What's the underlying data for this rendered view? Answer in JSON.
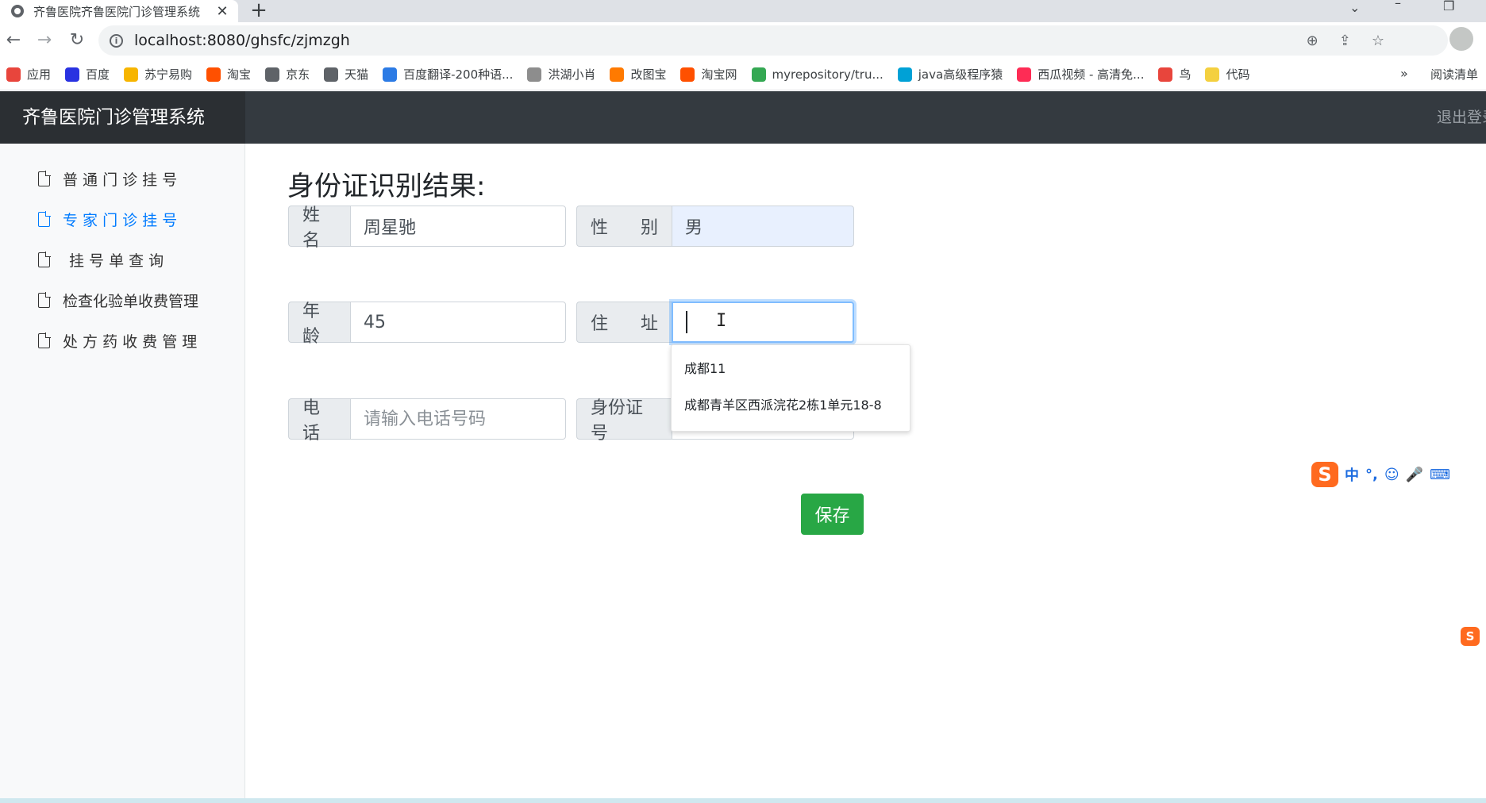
{
  "browser": {
    "tab_title": "齐鲁医院齐鲁医院门诊管理系统",
    "tab_close": "✕",
    "new_tab": "+",
    "url": "localhost:8080/ghsfc/zjmzgh",
    "bookmarks": [
      {
        "label": "应用",
        "color": "#e8453c"
      },
      {
        "label": "百度",
        "color": "#2932e1"
      },
      {
        "label": "苏宁易购",
        "color": "#f7b500"
      },
      {
        "label": "淘宝",
        "color": "#ff5000"
      },
      {
        "label": "京东",
        "color": "#5f6368"
      },
      {
        "label": "天猫",
        "color": "#5f6368"
      },
      {
        "label": "百度翻译-200种语...",
        "color": "#2c7be5"
      },
      {
        "label": "洪湖小肖",
        "color": "#8d8d8d"
      },
      {
        "label": "改图宝",
        "color": "#ff7a00"
      },
      {
        "label": "淘宝网",
        "color": "#ff5000"
      },
      {
        "label": "myrepository/tru...",
        "color": "#34a853"
      },
      {
        "label": "java高级程序猿",
        "color": "#00a1d6"
      },
      {
        "label": "西瓜视频 - 高清免...",
        "color": "#fe2c55"
      },
      {
        "label": "鸟",
        "color": "#e8453c"
      },
      {
        "label": "代码",
        "color": "#f4d03f"
      }
    ],
    "bookmarks_more": "»",
    "reading_list": "阅读清单"
  },
  "app": {
    "brand": "齐鲁医院门诊管理系统",
    "logout": "退出登录"
  },
  "sidebar": {
    "items": [
      {
        "label": "普 通 门 诊 挂 号",
        "active": false
      },
      {
        "label": "专 家 门 诊 挂 号",
        "active": true
      },
      {
        "label": "挂 号 单 查 询",
        "active": false
      },
      {
        "label": "检查化验单收费管理",
        "active": false
      },
      {
        "label": "处 方 药 收 费 管 理",
        "active": false
      }
    ]
  },
  "form": {
    "title": "身份证识别结果:",
    "name_label": "姓名",
    "name_value": "周星驰",
    "gender_label_a": "性",
    "gender_label_b": "别",
    "gender_value": "男",
    "age_label": "年龄",
    "age_value": "45",
    "address_label_a": "住",
    "address_label_b": "址",
    "address_value": "",
    "phone_label": "电话",
    "phone_placeholder": "请输入电话号码",
    "id_label": "身份证号",
    "save_label": "保存"
  },
  "autocomplete": {
    "options": [
      "成都11",
      "成都青羊区西派浣花2栋1单元18-8"
    ]
  },
  "ime": {
    "logo": "S",
    "mode": "中",
    "punct": "°,",
    "emoji": "☺",
    "mic": "🎤",
    "keyboard": "⌨"
  }
}
